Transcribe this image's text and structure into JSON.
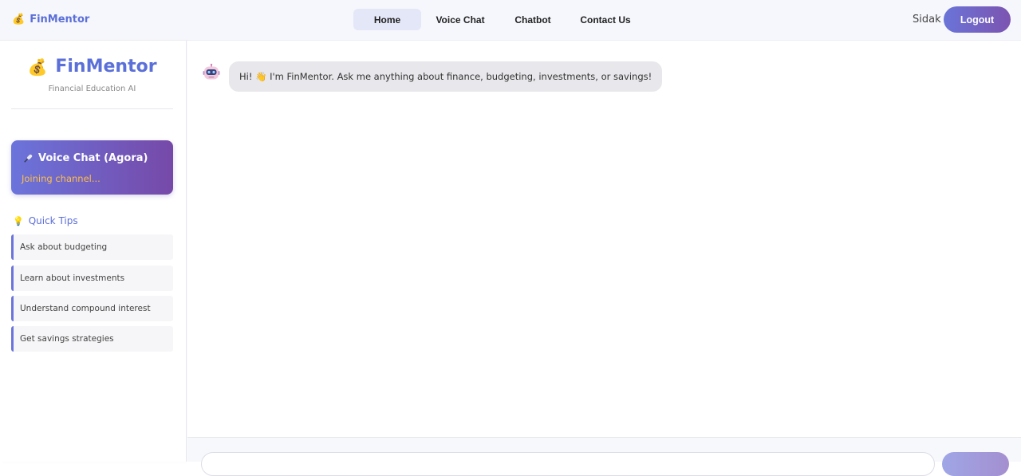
{
  "navbar": {
    "brand_icon": "money-bag-icon",
    "brand": "FinMentor",
    "links": [
      "Home",
      "Voice Chat",
      "Chatbot",
      "Contact Us"
    ],
    "active_link": "Home",
    "user_name": "Sidak",
    "logout_label": "Logout"
  },
  "sidebar": {
    "brand_icon": "money-bag-icon",
    "title": "FinMentor",
    "subtitle": "Financial Education AI",
    "voice_card": {
      "icon": "microphone-icon",
      "title": "Voice Chat (Agora)",
      "status": "Joining channel..."
    },
    "tips_icon": "lightbulb-icon",
    "tips_title": "Quick Tips",
    "tips": [
      "Ask about budgeting",
      "Learn about investments",
      "Understand compound interest",
      "Get savings strategies"
    ]
  },
  "chat": {
    "messages": [
      {
        "sender": "bot",
        "avatar": "robot-icon",
        "text": "Hi! 👋 I'm FinMentor. Ask me anything about finance, budgeting, investments, or savings!"
      }
    ],
    "input_placeholder": ""
  },
  "colors": {
    "accent": "#5b6fd8",
    "gradient_start": "#6b74db",
    "gradient_end": "#7649a8",
    "status": "#ffbf47"
  }
}
